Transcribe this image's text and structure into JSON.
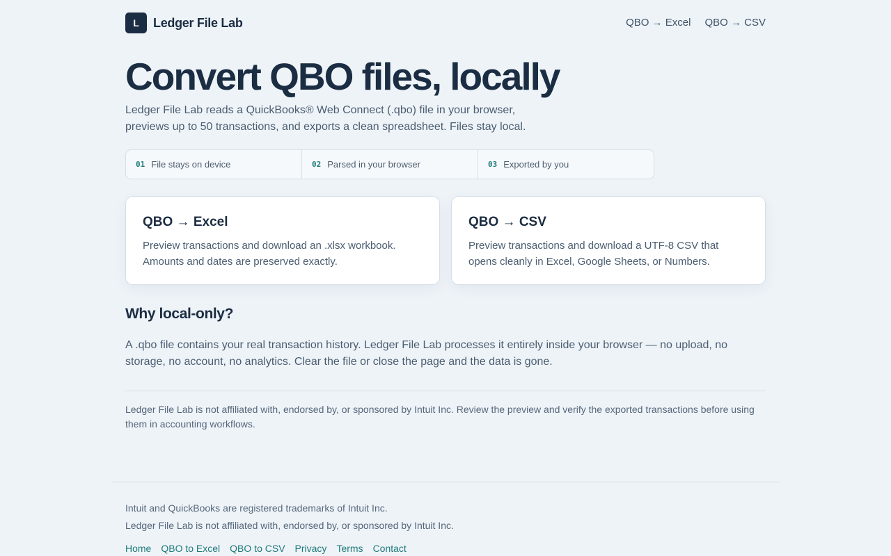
{
  "header": {
    "logo_letter": "L",
    "brand": "Ledger File Lab",
    "nav": [
      {
        "label": "QBO → Excel"
      },
      {
        "label": "QBO → CSV"
      }
    ]
  },
  "hero": {
    "title": "Convert QBO files, locally",
    "lead": "Ledger File Lab reads a QuickBooks® Web Connect (.qbo) file in your browser, previews up to 50 transactions, and exports a clean spreadsheet. Files stay local."
  },
  "steps": [
    {
      "num": "01",
      "label": "File stays on device"
    },
    {
      "num": "02",
      "label": "Parsed in your browser"
    },
    {
      "num": "03",
      "label": "Exported by you"
    }
  ],
  "cards": [
    {
      "title": "QBO → Excel",
      "text": "Preview transactions and download an .xlsx workbook. Amounts and dates are preserved exactly."
    },
    {
      "title": "QBO → CSV",
      "text": "Preview transactions and download a UTF-8 CSV that opens cleanly in Excel, Google Sheets, or Numbers."
    }
  ],
  "why": {
    "heading": "Why local-only?",
    "text": "A .qbo file contains your real transaction history. Ledger File Lab processes it entirely inside your browser — no upload, no storage, no account, no analytics. Clear the file or close the page and the data is gone."
  },
  "disclaimer": "Ledger File Lab is not affiliated with, endorsed by, or sponsored by Intuit Inc. Review the preview and verify the exported transactions before using them in accounting workflows.",
  "footer": {
    "line1": "Intuit and QuickBooks are registered trademarks of Intuit Inc.",
    "line2": "Ledger File Lab is not affiliated with, endorsed by, or sponsored by Intuit Inc.",
    "links": [
      {
        "label": "Home"
      },
      {
        "label": "QBO to Excel"
      },
      {
        "label": "QBO to CSV"
      },
      {
        "label": "Privacy"
      },
      {
        "label": "Terms"
      },
      {
        "label": "Contact"
      }
    ]
  }
}
